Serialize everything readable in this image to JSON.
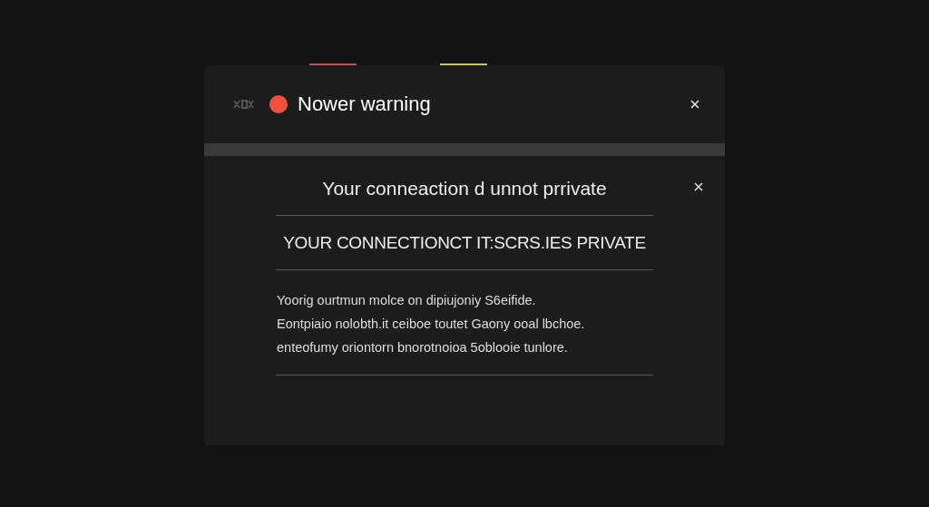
{
  "dialog": {
    "title": "Nower warning",
    "heading": "Your conneaction d unnot prrivate",
    "subheading": "YOUR CONNECTIONCT IT:SCRS.IES PRIVATE",
    "body": [
      "Yoorig ourtmun molce on dipiujoniy S6eifide.",
      "Eontpiaio nolobth.it ceiboe toutet Gaony ooal lbchoe.",
      "enteofumy oriontorn bnorotnoioa 5oblooie tunlore."
    ]
  }
}
